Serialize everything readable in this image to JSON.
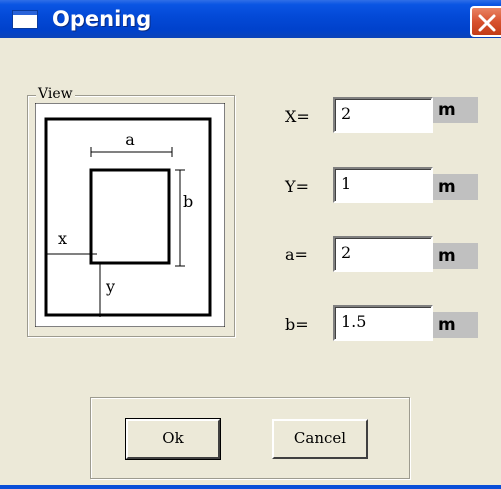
{
  "window": {
    "title": "Opening",
    "close_icon": "close-icon"
  },
  "view": {
    "group_label": "View",
    "labels": {
      "a": "a",
      "b": "b",
      "x": "x",
      "y": "y"
    }
  },
  "fields": [
    {
      "label": "X=",
      "value": "2",
      "unit": "m"
    },
    {
      "label": "Y=",
      "value": "1",
      "unit": "m"
    },
    {
      "label": "a=",
      "value": "2",
      "unit": "m"
    },
    {
      "label": "b=",
      "value": "1.5",
      "unit": "m"
    }
  ],
  "buttons": {
    "ok": "Ok",
    "cancel": "Cancel"
  },
  "colors": {
    "titlebar": "#0349d6",
    "dialog_bg": "#ECE9D8",
    "close": "#d8522f",
    "unit_bg": "#c0c0c0"
  }
}
